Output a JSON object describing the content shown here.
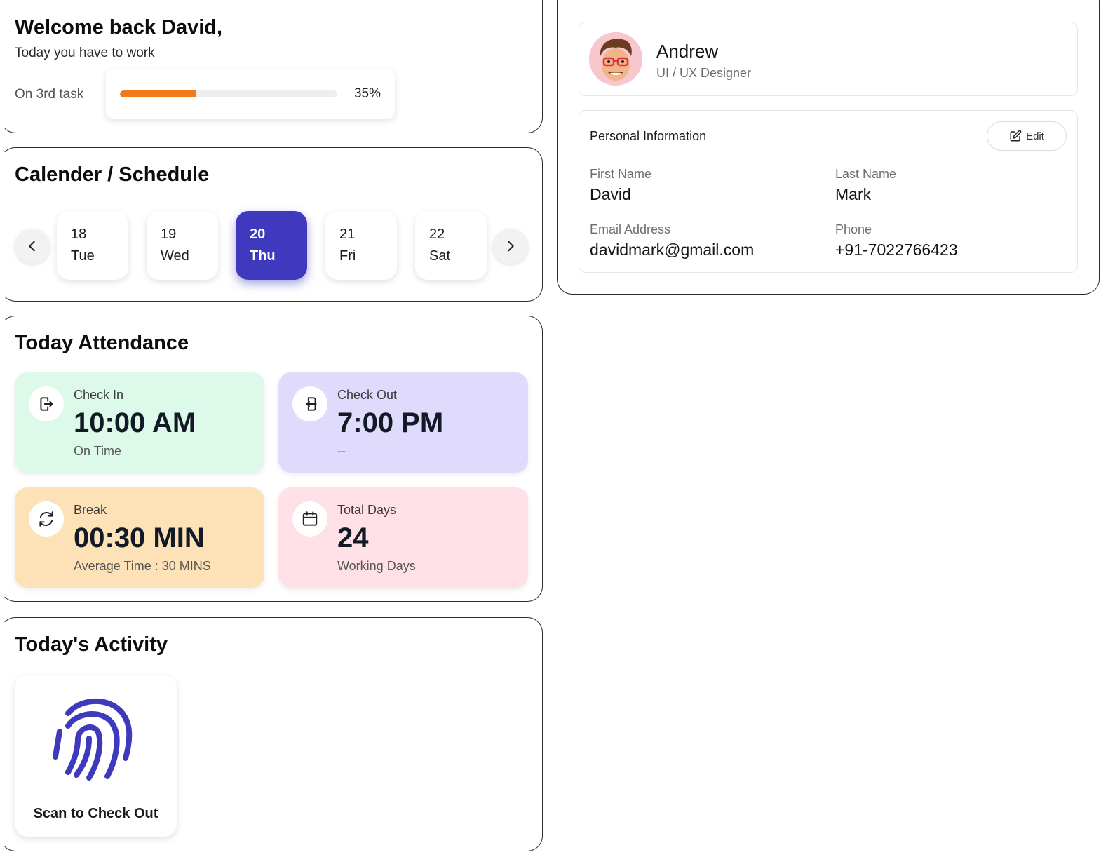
{
  "welcome": {
    "title": "Welcome back David,",
    "subtitle": "Today you have to work",
    "task_label": "On 3rd task",
    "progress_percent": 35,
    "progress_text": "35%",
    "progress_color": "#f27a1a"
  },
  "calendar": {
    "title": "Calender / Schedule",
    "days": [
      {
        "num": "18",
        "dow": "Tue"
      },
      {
        "num": "19",
        "dow": "Wed"
      },
      {
        "num": "20",
        "dow": "Thu",
        "active": true
      },
      {
        "num": "21",
        "dow": "Fri"
      },
      {
        "num": "22",
        "dow": "Sat"
      }
    ],
    "active_color": "#3f39be",
    "prev_icon": "chevron-left-icon",
    "next_icon": "chevron-right-icon"
  },
  "attendance": {
    "title": "Today Attendance",
    "cards": [
      {
        "label": "Check In",
        "value": "10:00 AM",
        "foot": "On Time",
        "icon": "login-icon",
        "bg": "#ddf9e9"
      },
      {
        "label": "Check Out",
        "value": "7:00 PM",
        "foot": "--",
        "icon": "logout-icon",
        "bg": "#e0dafd"
      },
      {
        "label": "Break",
        "value": "00:30 MIN",
        "foot": "Average Time : 30 MINS",
        "icon": "refresh-icon",
        "bg": "#fde2b7"
      },
      {
        "label": "Total Days",
        "value": "24",
        "foot": "Working Days",
        "icon": "calendar-icon",
        "bg": "#ffe0e6"
      }
    ]
  },
  "activity": {
    "title": "Today's Activity",
    "scan_label": "Scan to Check Out",
    "icon": "fingerprint-icon",
    "icon_color": "#3f39be"
  },
  "profile": {
    "name": "Andrew",
    "role": "UI / UX Designer",
    "avatar_icon": "memoji-avatar",
    "section_title": "Personal Information",
    "edit_label": "Edit",
    "fields": {
      "first_name_label": "First Name",
      "first_name": "David",
      "last_name_label": "Last Name",
      "last_name": "Mark",
      "email_label": "Email Address",
      "email": "davidmark@gmail.com",
      "phone_label": "Phone",
      "phone": "+91-7022766423"
    }
  }
}
